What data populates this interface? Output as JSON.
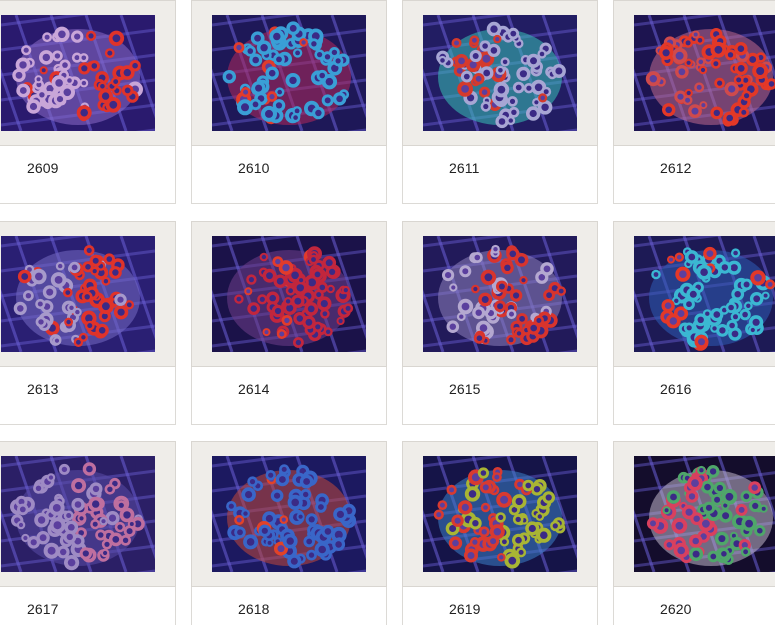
{
  "items": [
    {
      "label": "2609",
      "palette": [
        "#2a1a6e",
        "#c9a6d8",
        "#e0332a",
        "#8b6cc8"
      ],
      "mix": 0.55
    },
    {
      "label": "2610",
      "palette": [
        "#1e1858",
        "#e23b2b",
        "#3a9fd6",
        "#b22a5c"
      ],
      "mix": 0.15
    },
    {
      "label": "2611",
      "palette": [
        "#221d63",
        "#d53a2c",
        "#a7a6d4",
        "#39c1b8"
      ],
      "mix": 0.3
    },
    {
      "label": "2612",
      "palette": [
        "#1d1450",
        "#cf4a4c",
        "#e33827",
        "#c06a8e"
      ],
      "mix": 0.35
    },
    {
      "label": "2613",
      "palette": [
        "#2a1f73",
        "#a79acb",
        "#e0332a",
        "#7569c2"
      ],
      "mix": 0.5
    },
    {
      "label": "2614",
      "palette": [
        "#1b1249",
        "#e23b2b",
        "#c2263d",
        "#6f3e8a"
      ],
      "mix": 0.2
    },
    {
      "label": "2615",
      "palette": [
        "#221a5a",
        "#b4a8d0",
        "#d8342d",
        "#8e81be"
      ],
      "mix": 0.45
    },
    {
      "label": "2616",
      "palette": [
        "#1d1a55",
        "#e33828",
        "#3bb7d2",
        "#2d5db6"
      ],
      "mix": 0.15
    },
    {
      "label": "2617",
      "palette": [
        "#2b1f66",
        "#9e8bc4",
        "#bf6f9f",
        "#5a4ba6"
      ],
      "mix": 0.6
    },
    {
      "label": "2618",
      "palette": [
        "#1c1960",
        "#e24228",
        "#3966c8",
        "#c2483a"
      ],
      "mix": 0.1
    },
    {
      "label": "2619",
      "palette": [
        "#151448",
        "#d83a30",
        "#a8b534",
        "#3c7fc8"
      ],
      "mix": 0.4
    },
    {
      "label": "2620",
      "palette": [
        "#140d2c",
        "#d9405e",
        "#4fa66a",
        "#c1b8cc"
      ],
      "mix": 0.45
    }
  ]
}
